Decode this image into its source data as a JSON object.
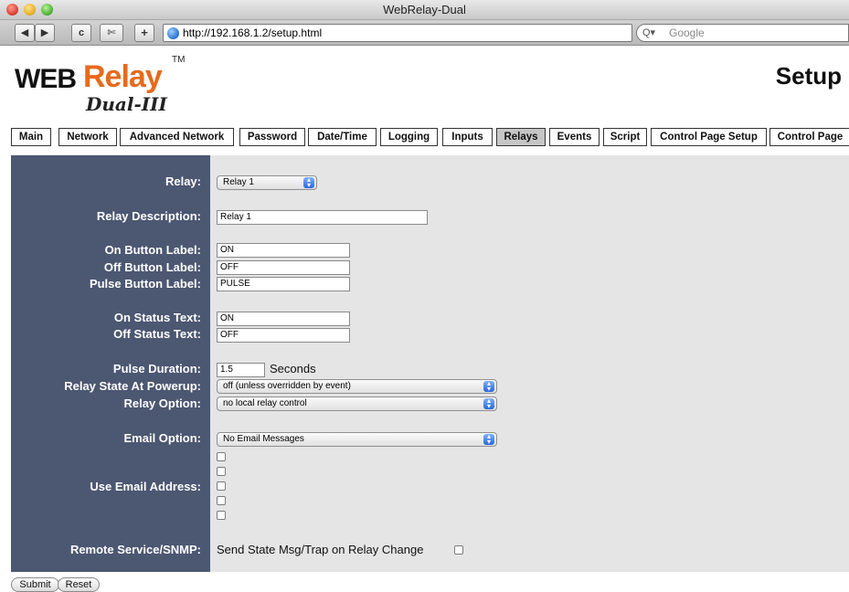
{
  "window": {
    "title": "WebRelay-Dual"
  },
  "toolbar": {
    "back_glyph": "◀",
    "forward_glyph": "▶",
    "reload_glyph": "c",
    "snap_glyph": "✄",
    "add_glyph": "+",
    "url": "http://192.168.1.2/setup.html",
    "search_placeholder": "Google",
    "search_glyph": "Q▾"
  },
  "header": {
    "logo_web": "WEB",
    "logo_relay": "Relay",
    "logo_tm": "TM",
    "logo_sub": "Dual-III",
    "page_title": "Setup"
  },
  "tabs": [
    "Main",
    "Network",
    "Advanced Network",
    "Password",
    "Date/Time",
    "Logging",
    "Inputs",
    "Relays",
    "Events",
    "Script",
    "Control Page Setup",
    "Control Page"
  ],
  "active_tab": "Relays",
  "form": {
    "relay_label": "Relay:",
    "relay_value": "Relay 1",
    "description_label": "Relay Description:",
    "description_value": "Relay 1",
    "on_button_label": "On Button Label:",
    "on_button_value": "ON",
    "off_button_label": "Off Button Label:",
    "off_button_value": "OFF",
    "pulse_button_label": "Pulse Button Label:",
    "pulse_button_value": "PULSE",
    "on_status_label": "On Status Text:",
    "on_status_value": "ON",
    "off_status_label": "Off Status Text:",
    "off_status_value": "OFF",
    "pulse_duration_label": "Pulse Duration:",
    "pulse_duration_value": "1.5",
    "pulse_duration_unit": "Seconds",
    "powerup_label": "Relay State At Powerup:",
    "powerup_value": "off (unless overridden by event)",
    "relay_option_label": "Relay Option:",
    "relay_option_value": "no local relay control",
    "email_option_label": "Email Option:",
    "email_option_value": "No Email Messages",
    "use_email_label": "Use Email Address:",
    "email_checkbox_count": 5,
    "snmp_label": "Remote Service/SNMP:",
    "snmp_text": "Send State Msg/Trap on Relay Change"
  },
  "buttons": {
    "submit": "Submit",
    "reset": "Reset"
  },
  "colors": {
    "label_panel": "#4c5772",
    "input_panel": "#e5e5e5",
    "logo_accent": "#e76a1c",
    "active_tab": "#c6c6c6"
  }
}
